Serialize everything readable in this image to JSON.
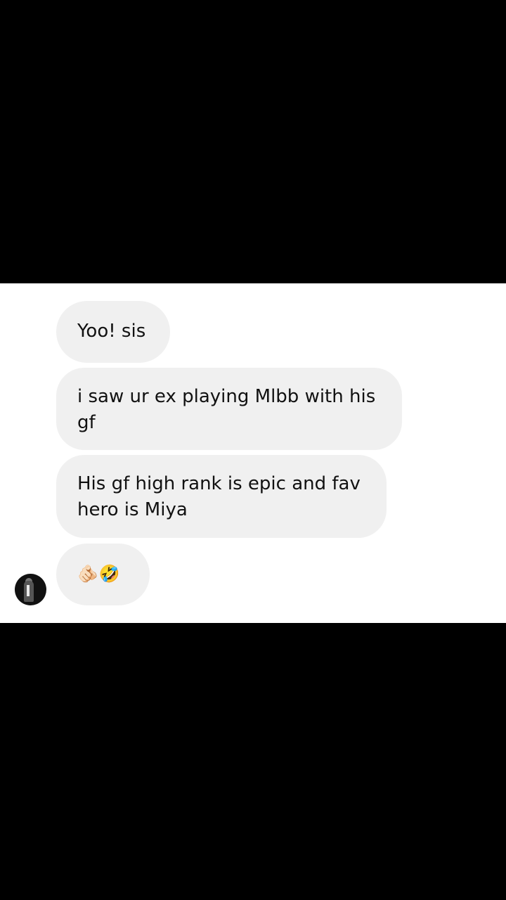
{
  "conversation": {
    "messages": [
      {
        "text": "Yoo! sis"
      },
      {
        "text": "i saw ur ex playing Mlbb with his gf"
      },
      {
        "text": "His gf high rank is epic and fav hero is Miya"
      },
      {
        "text": "🫵🏻🤣"
      }
    ]
  },
  "colors": {
    "bubble_background": "#f0f0f0",
    "chat_background": "#ffffff",
    "letterbox": "#000000",
    "text": "#111111"
  },
  "icons": {
    "avatar": "profile-avatar-icon"
  }
}
